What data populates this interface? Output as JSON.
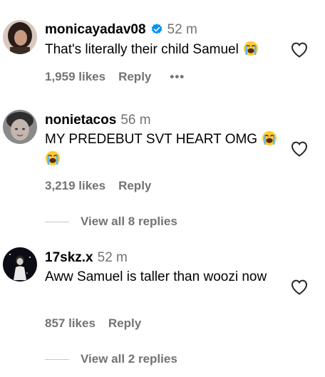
{
  "comments": [
    {
      "username": "monicayadav08",
      "verified": true,
      "time": "52 m",
      "text": "That's literally their child Samuel",
      "emoji": "loudly-crying-face",
      "likes": "1,959 likes",
      "reply": "Reply",
      "more": "•••"
    },
    {
      "username": "nonietacos",
      "verified": false,
      "time": "56 m",
      "text": "MY PREDEBUT SVT HEART OMG",
      "emoji": "loudly-crying-face",
      "likes": "3,219 likes",
      "reply": "Reply",
      "view_replies": "View all 8 replies"
    },
    {
      "username": "17skz.x",
      "verified": false,
      "time": "52 m",
      "text": "Aww Samuel is taller than woozi now",
      "likes": "857 likes",
      "reply": "Reply",
      "view_replies": "View all 2 replies"
    }
  ],
  "colors": {
    "secondary_text": "#737373",
    "verified_blue": "#0095f6",
    "divider": "#c7c7c7"
  },
  "icons": {
    "like": "heart-outline-icon",
    "verified": "verified-badge-icon",
    "emoji": "loudly-crying-face"
  }
}
